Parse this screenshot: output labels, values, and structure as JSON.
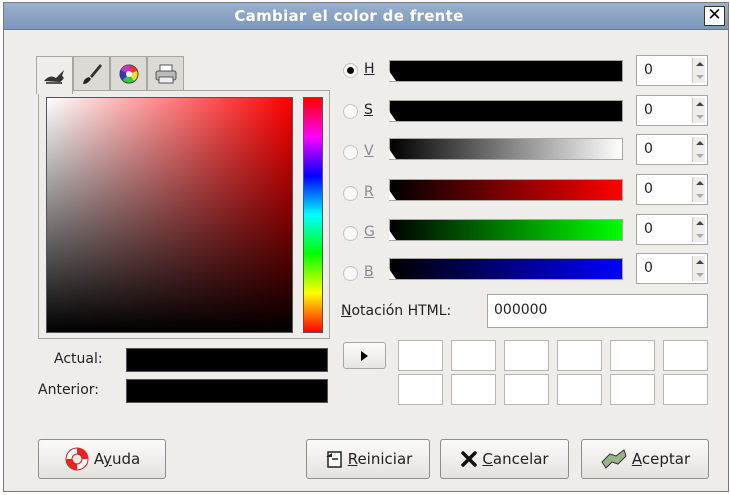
{
  "window": {
    "title": "Cambiar el color de frente",
    "close_glyph": "✕"
  },
  "tabs": [
    {
      "icon": "scales-icon",
      "active": true
    },
    {
      "icon": "paintbrush-icon",
      "active": false
    },
    {
      "icon": "color-wheel-icon",
      "active": false
    },
    {
      "icon": "printer-icon",
      "active": false
    }
  ],
  "current_color": {
    "hex": "#000000"
  },
  "colors": {
    "accent": "#7c97ba",
    "title_text": "#ffffff"
  },
  "swatches": {
    "actual_label": "Actual:",
    "anterior_label": "Anterior:"
  },
  "channels": [
    {
      "letter": "H",
      "value": "0",
      "selected": true
    },
    {
      "letter": "S",
      "value": "0",
      "selected": false
    },
    {
      "letter": "V",
      "value": "0",
      "selected": false
    },
    {
      "letter": "R",
      "value": "0",
      "selected": false
    },
    {
      "letter": "G",
      "value": "0",
      "selected": false
    },
    {
      "letter": "B",
      "value": "0",
      "selected": false
    }
  ],
  "html_notation": {
    "label_prefix": "N",
    "label_rest": "otación HTML:",
    "value": "000000"
  },
  "buttons": {
    "help": {
      "prefix": "A",
      "mnemonic": "y",
      "rest": "uda"
    },
    "reset": {
      "mnemonic": "R",
      "rest": "einiciar"
    },
    "cancel": {
      "mnemonic": "C",
      "rest": "ancelar"
    },
    "accept": {
      "mnemonic": "A",
      "rest": "ceptar"
    }
  }
}
